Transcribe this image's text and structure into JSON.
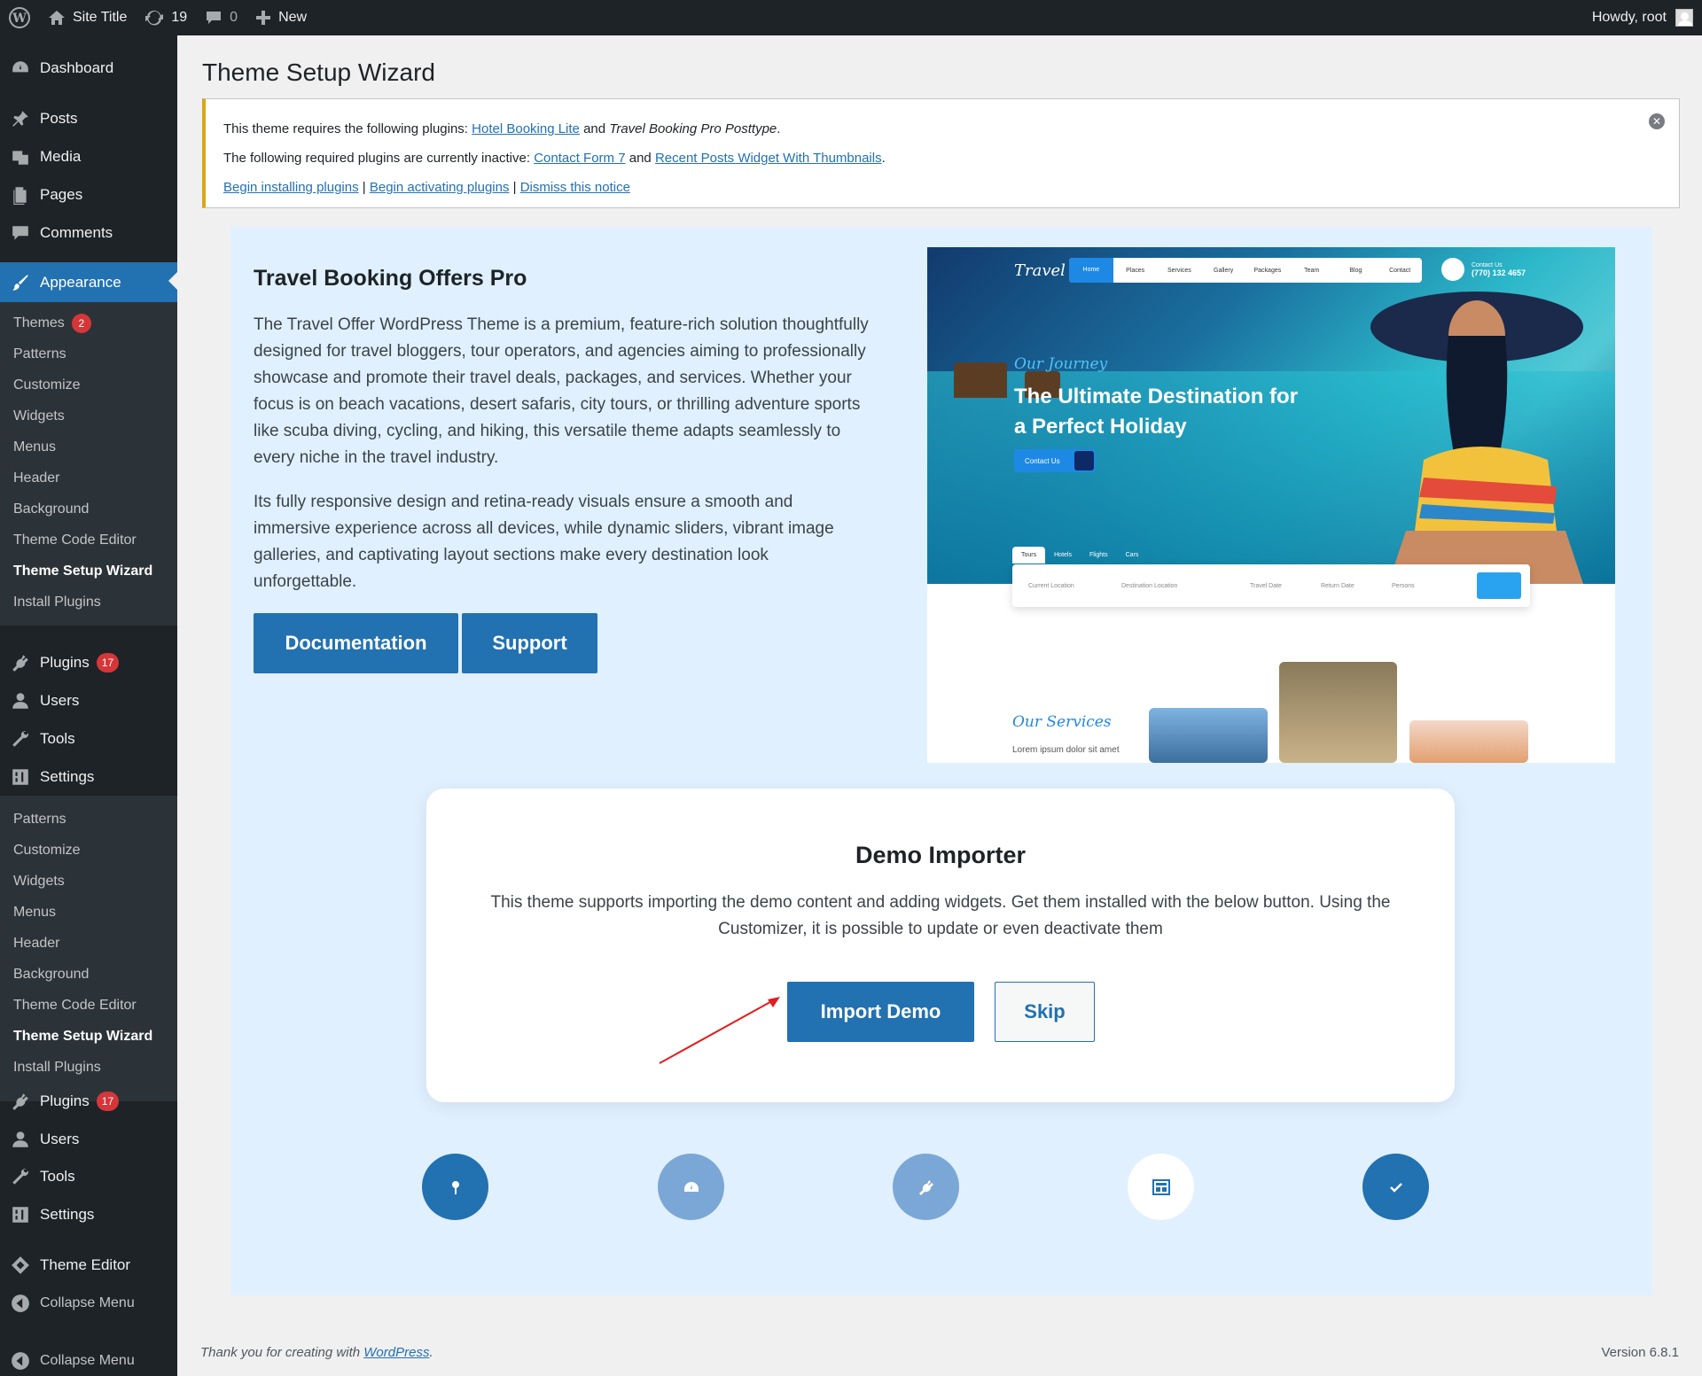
{
  "adminbar": {
    "site_title": "Site Title",
    "updates_count": "19",
    "comments_count": "0",
    "new_label": "New",
    "howdy": "Howdy, root"
  },
  "sidebar": {
    "dashboard": "Dashboard",
    "posts": "Posts",
    "media": "Media",
    "pages": "Pages",
    "comments": "Comments",
    "appearance": "Appearance",
    "appearance_sub": [
      "Themes",
      "Patterns",
      "Customize",
      "Widgets",
      "Menus",
      "Header",
      "Background",
      "Theme Code Editor",
      "Theme Setup Wizard",
      "Install Plugins"
    ],
    "themes_badge": "2",
    "plugins": "Plugins",
    "plugins_badge": "17",
    "users": "Users",
    "tools": "Tools",
    "settings": "Settings",
    "settings_sub": [
      "Patterns",
      "Customize",
      "Widgets",
      "Menus",
      "Header",
      "Background",
      "Theme Code Editor",
      "Theme Setup Wizard",
      "Install Plugins"
    ],
    "plugins2": "Plugins",
    "plugins2_badge": "17",
    "users2": "Users",
    "tools2": "Tools",
    "settings2": "Settings",
    "theme_editor": "Theme Editor",
    "collapse1": "Collapse Menu",
    "collapse2": "Collapse Menu"
  },
  "page": {
    "title": "Theme Setup Wizard"
  },
  "notice": {
    "line1_prefix": "This theme requires the following plugins:",
    "line1_link": "Hotel Booking Lite",
    "line1_and": "and",
    "line1_plugin2": "Travel Booking Pro Posttype",
    "line1_end": ".",
    "line2_prefix": "The following required plugins are currently inactive:",
    "line2_link1": "Contact Form 7",
    "line2_and": "and",
    "line2_link2": "Recent Posts Widget With Thumbnails",
    "line2_end": ".",
    "action1": "Begin installing plugins",
    "action2": "Begin activating plugins",
    "action3": "Dismiss this notice",
    "sep": "|"
  },
  "theme": {
    "title": "Travel Booking Offers Pro",
    "para1": "The Travel Offer WordPress Theme is a premium, feature-rich solution thoughtfully designed for travel bloggers, tour operators, and agencies aiming to professionally showcase and promote their travel deals, packages, and services. Whether your focus is on beach vacations, desert safaris, city tours, or thrilling adventure sports like scuba diving, cycling, and hiking, this versatile theme adapts seamlessly to every niche in the travel industry.",
    "para2": "Its fully responsive design and retina-ready visuals ensure a smooth and immersive experience across all devices, while dynamic sliders, vibrant image galleries, and captivating layout sections make every destination look unforgettable.",
    "documentation_label": "Documentation",
    "support_label": "Support"
  },
  "preview": {
    "logo": "Travel",
    "nav": [
      "Home",
      "Places",
      "Services",
      "Gallery",
      "Packages",
      "Team",
      "Blog",
      "Contact"
    ],
    "contact_small": "Contact Us",
    "contact_phone": "(770) 132 4657",
    "subtitle": "Our Journey",
    "headline": "The Ultimate Destination for a Perfect Holiday",
    "cta": "Contact Us",
    "tabs": [
      "Tours",
      "Hotels",
      "Flights",
      "Cars"
    ],
    "search_fields": [
      "Current Location",
      "Destination Location",
      "Travel Date",
      "Return Date",
      "Persons"
    ],
    "services": "Our Services",
    "lorem": "Lorem ipsum dolor sit amet"
  },
  "demo": {
    "title": "Demo Importer",
    "description": "This theme supports importing the demo content and adding widgets. Get them installed with the below button. Using the Customizer, it is possible to update or even deactivate them",
    "import_label": "Import Demo",
    "skip_label": "Skip"
  },
  "steps": {
    "colors": [
      "#2271b1",
      "#7ba7d6",
      "#7ba7d6",
      "#ffffff",
      "#2271b1"
    ]
  },
  "footer": {
    "thanks_prefix": "Thank you for creating with",
    "wordpress_link": "WordPress",
    "thanks_end": ".",
    "version": "Version 6.8.1"
  },
  "colors": {
    "accent": "#2271b1",
    "admin_dark": "#1d2327",
    "notice_warning": "#dba617",
    "badge_red": "#d63638",
    "panel_bg": "#e0f0fe"
  }
}
